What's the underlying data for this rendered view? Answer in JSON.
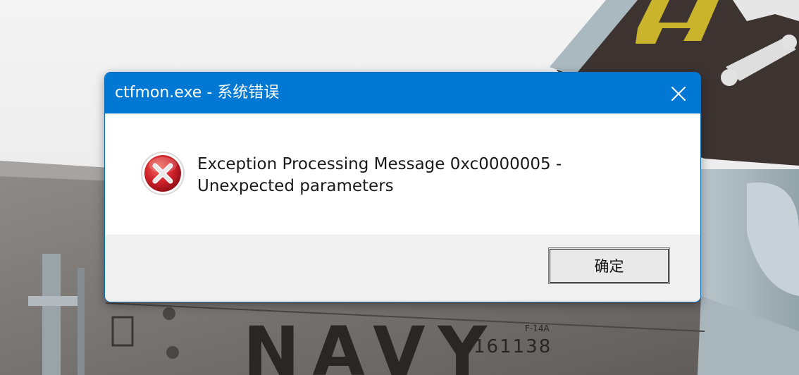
{
  "dialog": {
    "title": "ctfmon.exe - 系统错误",
    "message": "Exception Processing Message 0xc0000005 - Unexpected parameters",
    "ok_label": "确定",
    "icon": "error-icon"
  },
  "wallpaper": {
    "text_large": "NAVY",
    "text_serial": "161138",
    "text_model": "F-14A"
  },
  "colors": {
    "titlebar": "#0078d4",
    "footer": "#f0f0f0",
    "error_red": "#c4161c"
  }
}
